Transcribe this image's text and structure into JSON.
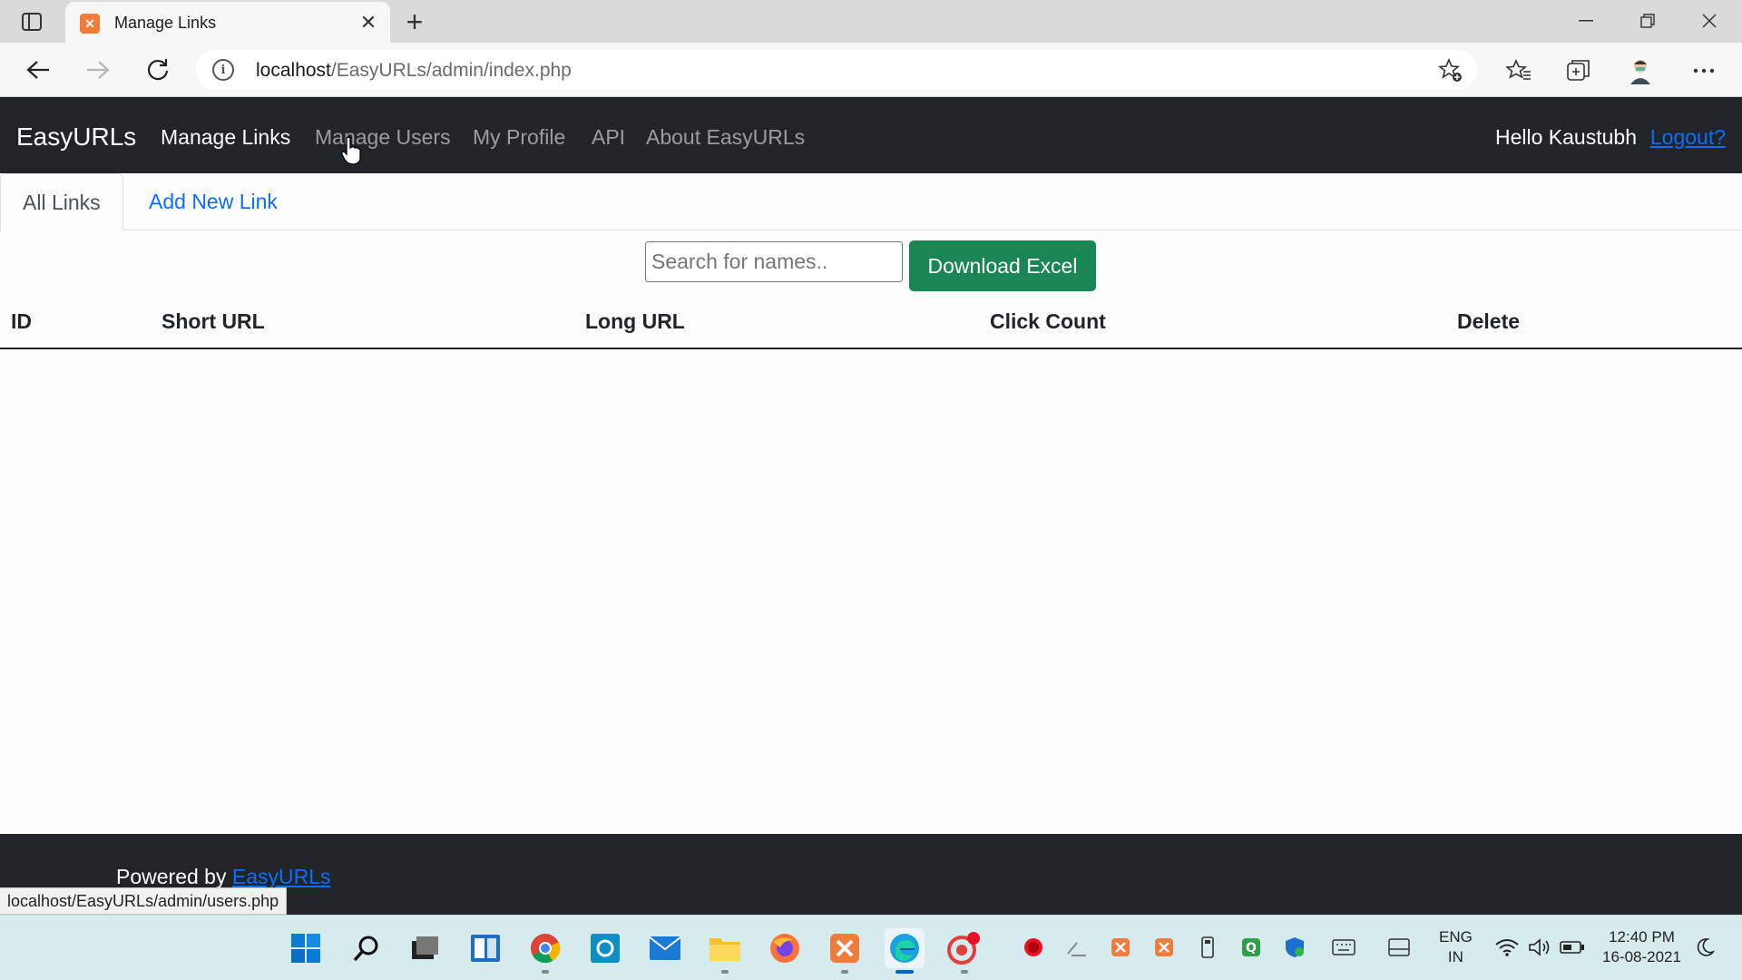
{
  "browser": {
    "tab_title": "Manage Links",
    "address_host": "localhost",
    "address_path": "/EasyURLs/admin/index.php",
    "status_url": "localhost/EasyURLs/admin/users.php"
  },
  "navbar": {
    "brand": "EasyURLs",
    "links": [
      "Manage Links",
      "Manage Users",
      "My Profile",
      "API",
      "About EasyURLs"
    ],
    "greeting": "Hello Kaustubh",
    "logout": "Logout?"
  },
  "tabs": {
    "all_links": "All Links",
    "add_new": "Add New Link"
  },
  "search": {
    "placeholder": "Search for names.."
  },
  "download_button": "Download Excel",
  "table": {
    "headers": [
      "ID",
      "Short URL",
      "Long URL",
      "Click Count",
      "Delete"
    ],
    "rows": []
  },
  "footer": {
    "powered_by": "Powered by",
    "link": "EasyURLs"
  },
  "taskbar": {
    "language_line1": "ENG",
    "language_line2": "IN",
    "time": "12:40 PM",
    "date": "16-08-2021"
  },
  "colors": {
    "navbar_bg": "#212529",
    "accent_link": "#0d6efd",
    "download_button": "#198754"
  }
}
